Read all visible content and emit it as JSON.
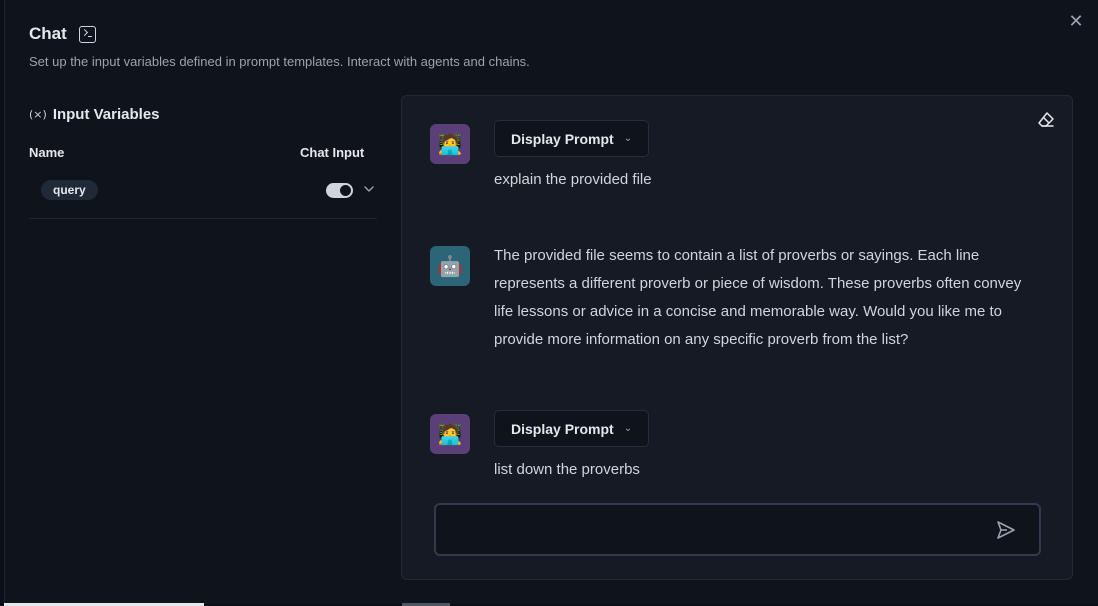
{
  "header": {
    "title": "Chat",
    "subtitle": "Set up the input variables defined in prompt templates. Interact with agents and chains."
  },
  "input_variables": {
    "title": "Input Variables",
    "icon": "variable-icon",
    "col_name": "Name",
    "col_chat_input": "Chat Input",
    "rows": [
      {
        "name": "query",
        "chat_input": true
      }
    ]
  },
  "chat": {
    "messages": [
      {
        "role": "user",
        "avatar": "🧑‍💻",
        "button": "Display Prompt",
        "text": "explain the provided file"
      },
      {
        "role": "bot",
        "avatar": "🤖",
        "text": "The provided file seems to contain a list of proverbs or sayings. Each line represents a different proverb or piece of wisdom. These proverbs often convey life lessons or advice in a concise and memorable way. Would you like me to provide more information on any specific proverb from the list?"
      },
      {
        "role": "user",
        "avatar": "🧑‍💻",
        "button": "Display Prompt",
        "text": "list down the proverbs"
      }
    ],
    "input_value": "",
    "input_placeholder": ""
  },
  "colors": {
    "user_avatar_bg": "#5b3f78",
    "bot_avatar_bg": "#2c6478",
    "panel_bg": "#151a24"
  }
}
